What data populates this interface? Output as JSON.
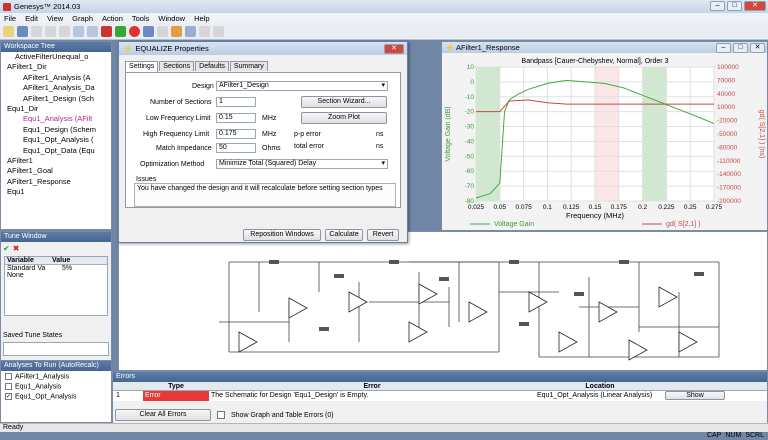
{
  "app": {
    "title": "Genesys™ 2014.03"
  },
  "menu": [
    "File",
    "Edit",
    "View",
    "Graph",
    "Action",
    "Tools",
    "Window",
    "Help"
  ],
  "workspace": {
    "header": "Workspace Tree",
    "items": [
      "ActiveFilterUnequal_o",
      "AFilter1_Dir",
      "AFilter1_Analysis (A",
      "AFilter1_Analysis_Da",
      "AFilter1_Design (Sch",
      "Equ1_Dir",
      "Equ1_Analysis (AFilt",
      "Equ1_Design (Schem",
      "Equ1_Opt_Analysis (",
      "Equ1_Opt_Data (Equ",
      "AFilter1",
      "AFilter1_Goal",
      "AFilter1_Response",
      "Equ1"
    ]
  },
  "tune": {
    "header": "Tune Window",
    "col_variable": "Variable",
    "col_value": "Value",
    "rows": [
      [
        "Standard Va",
        "5%"
      ],
      [
        "None",
        ""
      ]
    ],
    "saved_states": "Saved Tune States"
  },
  "analyses": {
    "header": "Analyses To Run (AutoRecalc)",
    "items": [
      "AFilter1_Analysis",
      "Equ1_Analysis",
      "Equ1_Opt_Analysis"
    ]
  },
  "dialog": {
    "title": "EQUALIZE Properties",
    "tabs": [
      "Settings",
      "Sections",
      "Defaults",
      "Summary"
    ],
    "design_label": "Design",
    "design_value": "AFilter1_Design",
    "sections_label": "Number of Sections",
    "sections_value": "1",
    "low_label": "Low Frequency Limit",
    "low_value": "0.15",
    "low_unit": "MHz",
    "high_label": "High Frequency Limit",
    "high_value": "0.175",
    "high_unit": "MHz",
    "imp_label": "Match Impedance",
    "imp_value": "50",
    "imp_unit": "Ohms",
    "opt_label": "Optimization Method",
    "opt_value": "Minimize Total (Squared) Delay",
    "section_wizard": "Section Wizard...",
    "zoom_plot": "Zoom Plot",
    "pp_error": "p-p error",
    "total_error": "total error",
    "ns": "ns",
    "issues_label": "Issues",
    "issues_text": "You have changed the design and it will recalculate before setting section types",
    "reposition": "Reposition Windows",
    "calculate": "Calculate",
    "revert": "Revert"
  },
  "graph": {
    "window_title": "AFilter1_Response"
  },
  "errors": {
    "header": "Errors",
    "col_type": "Type",
    "col_error": "Error",
    "col_location": "Location",
    "row": {
      "num": "1",
      "type": "Error",
      "error": "The Schematic for Design 'Equ1_Design' is Empty.",
      "location": "Equ1_Opt_Analysis (Linear Analysis)",
      "action": "Show"
    },
    "clear": "Clear All Errors",
    "show_graph": "Show Graph and Table Errors (0)"
  },
  "status": {
    "left": "Ready",
    "cap": "CAP",
    "num": "NUM",
    "scrl": "SCRL"
  },
  "chart_data": {
    "type": "line",
    "title": "Bandpass [Cauer-Chebyshev, Normal], Order 3",
    "xlabel": "Frequency (MHz)",
    "ylabel": "Voltage Gain (dB)",
    "y2label": "gd( S[2,1] ) (ns)",
    "xlim": [
      0.025,
      0.275
    ],
    "ylim": [
      -80,
      10
    ],
    "y2lim": [
      -200000,
      100000
    ],
    "xticks": [
      "0.025",
      "0.05",
      "0.075",
      "0.1",
      "0.125",
      "0.15",
      "0.175",
      "0.2",
      "0.225",
      "0.25",
      "0.275"
    ],
    "yticks": [
      "10",
      "0",
      "-10",
      "-20",
      "-30",
      "-40",
      "-50",
      "-60",
      "-70",
      "-80"
    ],
    "y2ticks": [
      "100000",
      "70000",
      "40000",
      "10000",
      "-20000",
      "-50000",
      "-80000",
      "-110000",
      "-140000",
      "-170000",
      "-200000"
    ],
    "series": [
      {
        "name": "Voltage Gain",
        "color": "#3fae3f",
        "axis": "y",
        "x": [
          0.025,
          0.04,
          0.05,
          0.055,
          0.06,
          0.07,
          0.08,
          0.09,
          0.1,
          0.12,
          0.14,
          0.16,
          0.18,
          0.2,
          0.22,
          0.24,
          0.26,
          0.275
        ],
        "y": [
          -78,
          -75,
          -68,
          -20,
          -12,
          -8,
          -5,
          -3,
          -1,
          1,
          0,
          -1,
          -4,
          -9,
          -14,
          -19,
          -24,
          -28
        ]
      },
      {
        "name": "gd( S[2,1] )",
        "color": "#c44a4a",
        "axis": "y2",
        "x": [
          0.025,
          0.05,
          0.06,
          0.08,
          0.1,
          0.12,
          0.14,
          0.16,
          0.18,
          0.2,
          0.22,
          0.25,
          0.275
        ],
        "y": [
          0,
          0,
          24000,
          26000,
          20000,
          17000,
          17000,
          17000,
          17000,
          17000,
          17000,
          17000,
          17000
        ]
      }
    ],
    "legend": [
      "Voltage Gain",
      "gd( S[2,1] )"
    ]
  }
}
